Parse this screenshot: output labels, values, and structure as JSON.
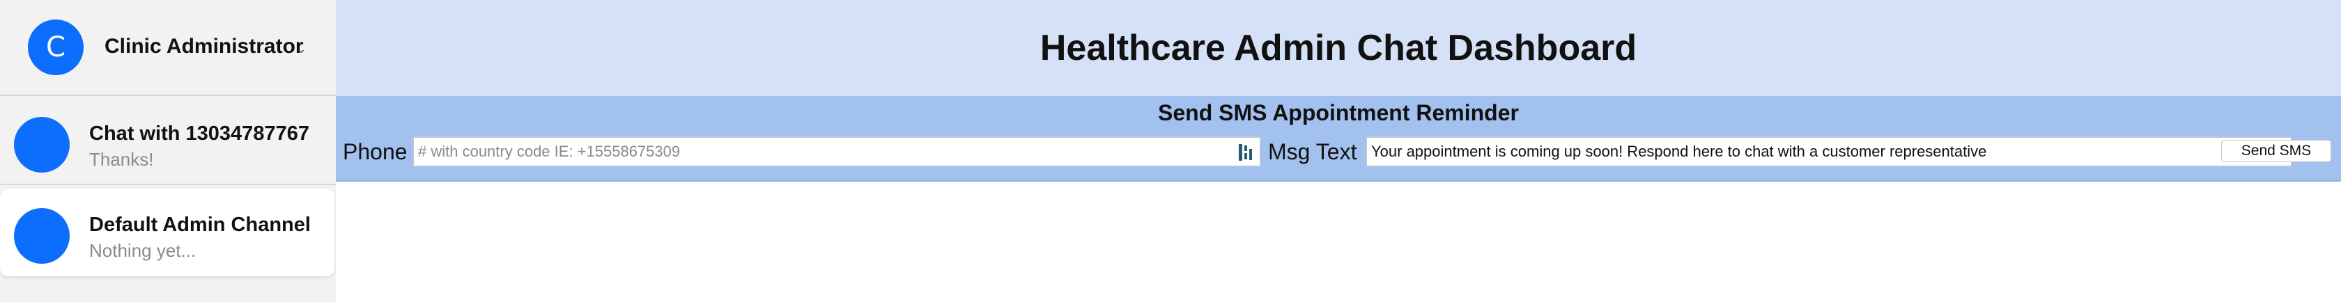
{
  "user": {
    "avatar_initial": "C",
    "name": "Clinic Administrator",
    "chevron": "⌄"
  },
  "channels": [
    {
      "title": "Chat with 13034787767",
      "subtitle": "Thanks!"
    },
    {
      "title": "Default Admin Channel",
      "subtitle": "Nothing yet..."
    }
  ],
  "header": {
    "title": "Healthcare Admin Chat Dashboard"
  },
  "sms_form": {
    "title": "Send SMS Appointment Reminder",
    "phone_label": "Phone",
    "phone_value": "",
    "phone_placeholder": "# with country code IE: +15558675309",
    "msg_label": "Msg Text",
    "msg_value": "Your appointment is coming up soon! Respond here to chat with a customer representative",
    "send_label": "Send SMS"
  },
  "icons": {
    "password_manager": "password-manager-icon"
  },
  "colors": {
    "accent": "#0d6efd",
    "header_bg": "#d4e1f7",
    "panel_bg": "#a3c1ef",
    "sidebar_bg": "#f2f2f2",
    "pm_icon": "#1f5e73"
  }
}
